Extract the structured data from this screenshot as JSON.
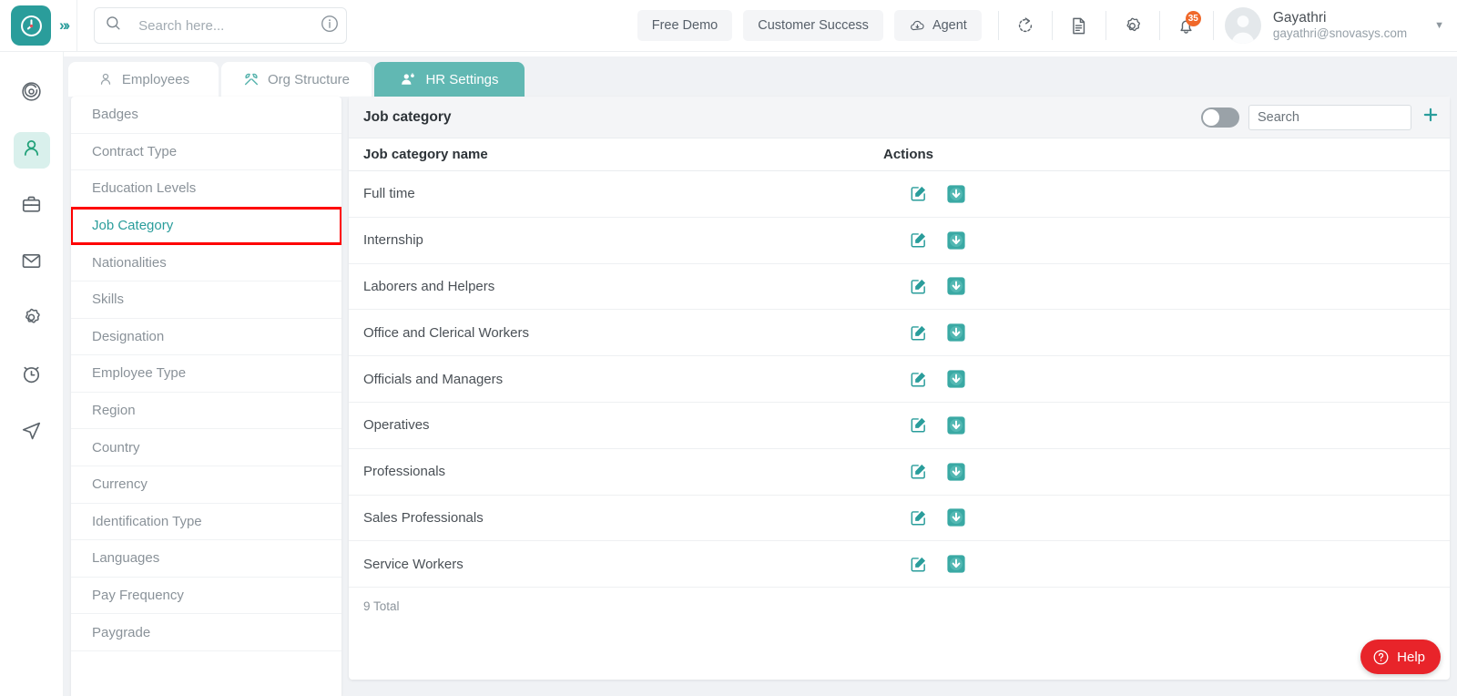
{
  "header": {
    "logo_icon": "clock-logo-icon",
    "expand_icon": "chevrons-right-icon",
    "search": {
      "placeholder": "Search here...",
      "value": "",
      "icon": "search-icon",
      "info_icon": "info-icon"
    },
    "buttons": [
      {
        "label": "Free Demo",
        "name": "free-demo-button",
        "icon": null
      },
      {
        "label": "Customer Success",
        "name": "customer-success-button",
        "icon": null
      },
      {
        "label": "Agent",
        "name": "agent-button",
        "icon": "cloud-download-icon"
      }
    ],
    "icons": [
      {
        "name": "refresh-icon"
      },
      {
        "name": "document-icon"
      },
      {
        "name": "gear-icon"
      },
      {
        "name": "bell-icon"
      }
    ],
    "notification_count": "35",
    "user": {
      "name": "Gayathri",
      "email": "gayathri@snovasys.com",
      "avatar_icon": "avatar-icon",
      "caret_icon": "chevron-down-icon"
    }
  },
  "rail": {
    "items": [
      {
        "name": "sidebar-item-dashboard",
        "icon": "target-icon",
        "active": false
      },
      {
        "name": "sidebar-item-people",
        "icon": "user-icon",
        "active": true
      },
      {
        "name": "sidebar-item-briefcase",
        "icon": "briefcase-icon",
        "active": false
      },
      {
        "name": "sidebar-item-mail",
        "icon": "mail-icon",
        "active": false
      },
      {
        "name": "sidebar-item-settings",
        "icon": "gear-icon",
        "active": false
      },
      {
        "name": "sidebar-item-timer",
        "icon": "alarm-clock-icon",
        "active": false
      },
      {
        "name": "sidebar-item-send",
        "icon": "send-icon",
        "active": false
      }
    ]
  },
  "tabs": [
    {
      "label": "Employees",
      "icon": "person-icon",
      "active": false
    },
    {
      "label": "Org Structure",
      "icon": "tools-icon",
      "active": false
    },
    {
      "label": "HR Settings",
      "icon": "people-gear-icon",
      "active": true
    }
  ],
  "settings_list": {
    "items": [
      {
        "label": "Badges",
        "selected": false
      },
      {
        "label": "Contract Type",
        "selected": false
      },
      {
        "label": "Education Levels",
        "selected": false
      },
      {
        "label": "Job Category",
        "selected": true
      },
      {
        "label": "Nationalities",
        "selected": false
      },
      {
        "label": "Skills",
        "selected": false
      },
      {
        "label": "Designation",
        "selected": false
      },
      {
        "label": "Employee Type",
        "selected": false
      },
      {
        "label": "Region",
        "selected": false
      },
      {
        "label": "Country",
        "selected": false
      },
      {
        "label": "Currency",
        "selected": false
      },
      {
        "label": "Identification Type",
        "selected": false
      },
      {
        "label": "Languages",
        "selected": false
      },
      {
        "label": "Pay Frequency",
        "selected": false
      },
      {
        "label": "Paygrade",
        "selected": false
      }
    ]
  },
  "panel": {
    "title": "Job category",
    "toggle_on": false,
    "search": {
      "placeholder": "Search",
      "value": ""
    },
    "add_icon": "plus-icon",
    "columns": {
      "name": "Job category name",
      "actions": "Actions"
    },
    "rows": [
      {
        "name": "Full time"
      },
      {
        "name": "Internship"
      },
      {
        "name": "Laborers and Helpers"
      },
      {
        "name": "Office and Clerical Workers"
      },
      {
        "name": "Officials and Managers"
      },
      {
        "name": "Operatives"
      },
      {
        "name": "Professionals"
      },
      {
        "name": "Sales Professionals"
      },
      {
        "name": "Service Workers"
      }
    ],
    "row_action_icons": {
      "edit": "edit-pencil-icon",
      "archive": "download-box-icon"
    },
    "total": "9 Total"
  },
  "help": {
    "label": "Help",
    "icon": "question-circle-icon"
  },
  "colors": {
    "brand_teal": "#2a9d9b",
    "tab_active": "#61b8b3",
    "highlight_red": "#fe0000",
    "help_red": "#e8242a",
    "badge_orange": "#f0682a",
    "page_bg": "#f0f2f5"
  }
}
